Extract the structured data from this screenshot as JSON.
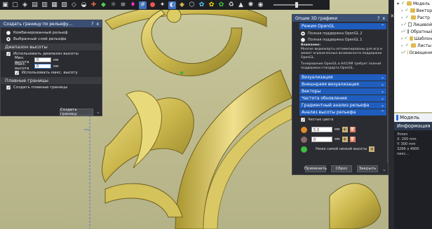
{
  "toolbar": {
    "buttons": [
      "cube-front",
      "cube-top",
      "cube-iso",
      "cube-left",
      "cube-right",
      "cube-back",
      "cube-bottom",
      "cube-persp",
      "shade",
      "axis",
      "colors",
      "light",
      "layers",
      "bulb",
      "grid",
      "snap",
      "render",
      "toggle1",
      "toggle2",
      "toggle3",
      "toggle4",
      "toggle5",
      "toggle6",
      "toggle7",
      "toggle8",
      "toggle9",
      "toggle10",
      "toggle11",
      "toggle12",
      "toggle13",
      "toggle14"
    ],
    "slider_level": 0.55
  },
  "tree": {
    "items": [
      {
        "label": "Модель",
        "type": "folder",
        "expanded": true
      },
      {
        "label": "Вектор",
        "type": "folder"
      },
      {
        "label": "Растр",
        "type": "folder"
      },
      {
        "label": "Лицевой",
        "type": "layer"
      },
      {
        "label": "Обратный",
        "type": "layer"
      },
      {
        "label": "Шаблон",
        "type": "folder"
      },
      {
        "label": "Листы",
        "type": "folder"
      },
      {
        "label": "Освещени",
        "type": "folder"
      }
    ]
  },
  "model_section": {
    "tab": "Модель",
    "info_title": "Информация о м",
    "lines": [
      "Эскиз",
      "X: 200 mm",
      "Y: 300 mm",
      "3266 x 4900 пикс..."
    ]
  },
  "left_panel": {
    "title": "Создать границу по рельефу...",
    "help": "?",
    "close": "x",
    "options": [
      "Комбинированный рельеф",
      "Выбранный слой рельефа"
    ],
    "selected_option": 1,
    "range_section": "Диапазон высоты",
    "use_range_label": "Использовать диапазон высоты",
    "min_label": "Мин. высота",
    "min_value": "0",
    "max_label": "Макс. высота",
    "max_value": "0",
    "unit": "мм",
    "use_max_label": "Использовать макс. высоту",
    "bounds_section": "Плавные границы",
    "create_bounds_label": "Создать плавные границы",
    "create_button": "Создать границу"
  },
  "right_panel": {
    "title": "Опции 3D графики",
    "help": "?",
    "close": "x",
    "opengl_header": "Режим OpenGL",
    "opengl_options": [
      "Полная поддержка OpenGL 2",
      "Полная поддержка OpenGL 1"
    ],
    "selected_opengl": 0,
    "note_title": "Внимание:",
    "note_text": "Многие видеокарты оптимизированы для игр и имеют ограниченные возможности поддержки OpenGL.",
    "note_text2": "Тонирование OpenGL в ArtCAM требует полной поддержки стандарта OpenGL.",
    "sections": [
      "Визуализация",
      "Внешнраяя визуализация",
      "Векторы",
      "Частота обновления",
      "Градиентный анализ рельефа",
      "Анализ высоты рельефа"
    ],
    "pure_colors_label": "Чистые цвета",
    "height_rows": [
      {
        "color": "#e08a2e",
        "value": "5.3",
        "unit": "мм"
      },
      {
        "color": "#8a6a6a",
        "value": "0",
        "unit": "мм"
      }
    ],
    "below_label": "Ниже самой низкой высоты",
    "below_color": "#3fbf3f",
    "buttons": [
      "Применить",
      "Сброс",
      "Закрыть"
    ]
  },
  "colors": {
    "accent": "#1f5dbf",
    "panel_bg": "#2b2c31",
    "title_bg": "#3a4f74",
    "relief_gold": "#c9b54a"
  }
}
